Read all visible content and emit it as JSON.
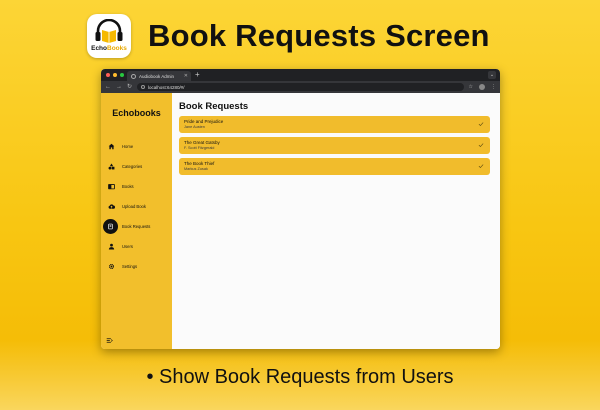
{
  "promo": {
    "headline": "Book Requests Screen",
    "logo": {
      "part1": "Echo",
      "part2": "Books",
      "icon": "headphones-book-icon"
    },
    "bullet": "Show Book Requests from Users"
  },
  "browser": {
    "tab_title": "Audiobook Admin",
    "url": "localhost:64280/#/",
    "new_tab_symbol": "+",
    "traffic_lights": [
      "#ff5f57",
      "#febc2e",
      "#28c840"
    ]
  },
  "sidebar": {
    "brand": "Echobooks",
    "items": [
      {
        "label": "Home",
        "icon": "home-icon"
      },
      {
        "label": "Categories",
        "icon": "categories-icon"
      },
      {
        "label": "Books",
        "icon": "books-icon"
      },
      {
        "label": "Upload Book",
        "icon": "cloud-upload-icon"
      },
      {
        "label": "Book Requests",
        "icon": "book-request-icon",
        "active": true
      },
      {
        "label": "Users",
        "icon": "person-icon"
      },
      {
        "label": "Settings",
        "icon": "gear-icon"
      }
    ]
  },
  "main": {
    "title": "Book Requests",
    "requests": [
      {
        "title": "Pride and Prejudice",
        "author": "Jane Austen"
      },
      {
        "title": "The Great Gatsby",
        "author": "F. Scott Fitzgerald"
      },
      {
        "title": "The Book Thief",
        "author": "Markus Zusak"
      }
    ]
  },
  "colors": {
    "accent": "#f2bf2c",
    "sidebar": "#f2bf2c",
    "background": "#f8c612"
  }
}
